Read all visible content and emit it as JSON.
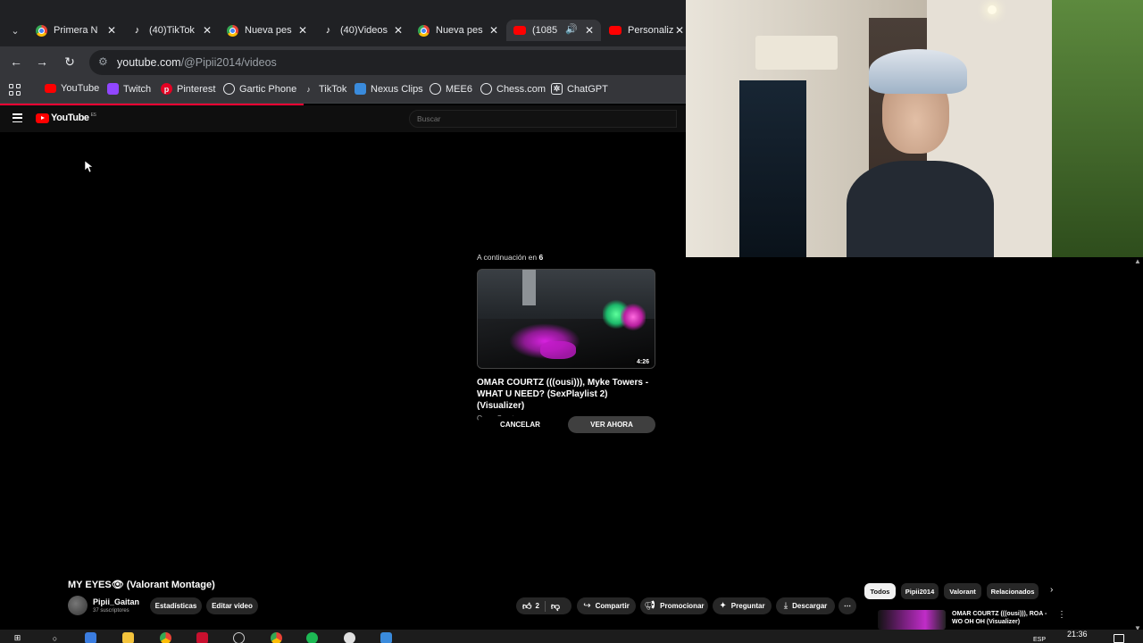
{
  "browser": {
    "tabs": [
      {
        "label": "Primera N",
        "icon": "chrome-icon",
        "active": false
      },
      {
        "label": "(40)TikTok",
        "icon": "tiktok-icon",
        "active": false
      },
      {
        "label": "Nueva pes",
        "icon": "chrome-icon",
        "active": false
      },
      {
        "label": "(40)Videos",
        "icon": "tiktok-icon",
        "active": false
      },
      {
        "label": "Nueva pes",
        "icon": "chrome-icon",
        "active": false
      },
      {
        "label": "(1085",
        "icon": "youtube-icon",
        "active": true
      },
      {
        "label": "Personaliz",
        "icon": "youtube-icon",
        "active": false
      }
    ],
    "url_host": "youtube.com",
    "url_path": "/@Pipii2014/videos",
    "bookmarks": [
      {
        "label": "YouTube",
        "icon": "youtube-icon"
      },
      {
        "label": "Twitch",
        "icon": "twitch-icon"
      },
      {
        "label": "Pinterest",
        "icon": "pinterest-icon"
      },
      {
        "label": "Gartic Phone",
        "icon": "chrome-icon"
      },
      {
        "label": "TikTok",
        "icon": "tiktok-icon"
      },
      {
        "label": "Nexus Clips",
        "icon": "nexus-icon"
      },
      {
        "label": "MEE6",
        "icon": "chrome-icon"
      },
      {
        "label": "Chess.com",
        "icon": "chrome-icon"
      },
      {
        "label": "ChatGPT",
        "icon": "chatgpt-icon"
      }
    ],
    "colors": {
      "tab_strip": "#202124",
      "toolbar": "#35363a",
      "loading_bar": "#ff0033"
    }
  },
  "youtube": {
    "logo_text": "YouTube",
    "logo_superscript": "ES",
    "search_placeholder": "Buscar",
    "up_next": {
      "header_prefix": "A continuación en",
      "countdown": "6",
      "video_title": "OMAR COURTZ (((ousi))), Myke Towers - WHAT U NEED? (SexPlaylist 2) (Visualizer)",
      "channel": "Omar Courtz",
      "duration": "4:26",
      "cancel_label": "CANCELAR",
      "watch_label": "VER AHORA"
    },
    "video": {
      "title": "MY EYES👁 (Valorant Montage)",
      "channel": "Pipii_Gaitan",
      "subscribers": "37 suscriptores",
      "stats_label": "Estadísticas",
      "edit_label": "Editar video",
      "likes": "2",
      "share_label": "Compartir",
      "promote_label": "Promocionar",
      "ask_label": "Preguntar",
      "download_label": "Descargar"
    },
    "chips": [
      "Todos",
      "Pipii2014",
      "Valorant",
      "Relacionados"
    ],
    "related_title": "OMAR COURTZ (((ousi))), ROA - WO OH OH (Visualizer)"
  },
  "taskbar": {
    "time": "21:36",
    "language": "ESP"
  }
}
